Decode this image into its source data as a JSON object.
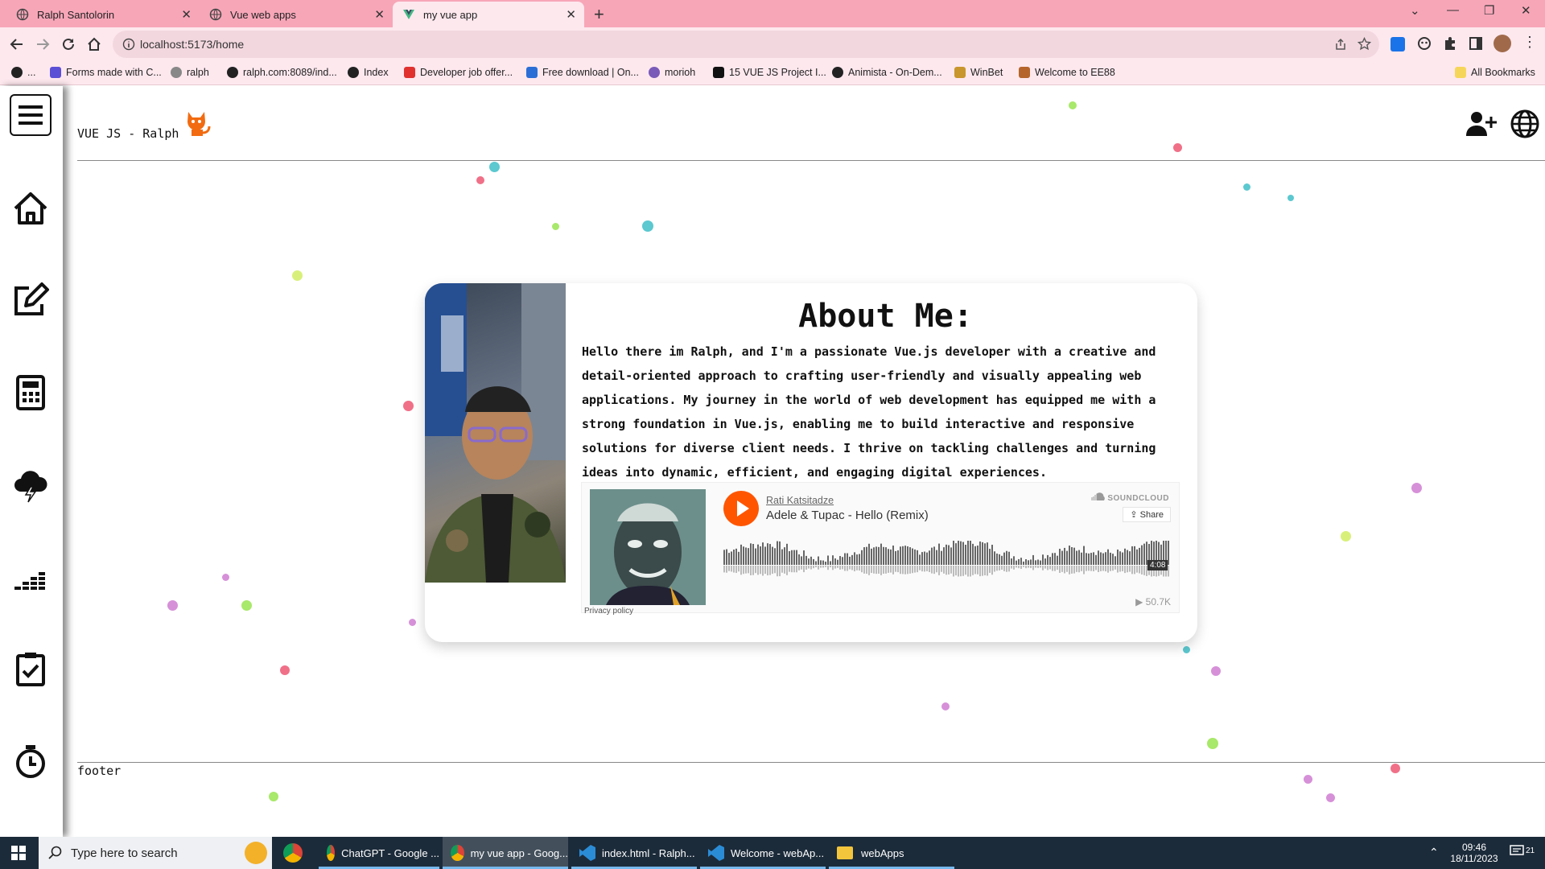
{
  "browser": {
    "tabs": [
      {
        "label": "Ralph Santolorin"
      },
      {
        "label": "Vue web apps"
      },
      {
        "label": "my vue app"
      }
    ],
    "url": "localhost:5173/home",
    "bookmarks": [
      {
        "label": "..."
      },
      {
        "label": "Forms made with C..."
      },
      {
        "label": "ralph"
      },
      {
        "label": "ralph.com:8089/ind..."
      },
      {
        "label": "Index"
      },
      {
        "label": "Developer job offer..."
      },
      {
        "label": "Free download | On..."
      },
      {
        "label": "morioh"
      },
      {
        "label": "15 VUE JS Project I..."
      },
      {
        "label": "Animista - On-Dem..."
      },
      {
        "label": "WinBet"
      },
      {
        "label": "Welcome to EE88"
      }
    ],
    "all_bookmarks": "All Bookmarks"
  },
  "app": {
    "title": "VUE JS - Ralph",
    "footer": "footer",
    "card": {
      "heading": "About Me:",
      "bio": "Hello there im Ralph, and I'm a passionate Vue.js developer with a creative and detail-oriented approach to crafting user-friendly and visually appealing web applications. My journey in the world of web development has equipped me with a strong foundation in Vue.js, enabling me to build interactive and responsive solutions for diverse client needs. I thrive on tackling challenges and turning ideas into dynamic, efficient, and engaging digital experiences."
    },
    "soundcloud": {
      "artist": "Rati Katsitadze",
      "track": "Adele & Tupac - Hello (Remix)",
      "brand": "SOUNDCLOUD",
      "share": "Share",
      "duration": "4:08",
      "plays": "50.7K",
      "privacy": "Privacy policy"
    }
  },
  "taskbar": {
    "search_placeholder": "Type here to search",
    "tasks": [
      {
        "label": "ChatGPT - Google ..."
      },
      {
        "label": "my vue app - Goog..."
      },
      {
        "label": "index.html - Ralph..."
      },
      {
        "label": "Welcome - webAp..."
      },
      {
        "label": "webApps"
      }
    ],
    "time": "09:46",
    "date": "18/11/2023",
    "notifications": "21"
  },
  "colors": {
    "tab_bar": "#f7a6b8",
    "toolbar": "#fde8ee",
    "soundcloud_orange": "#ff5500",
    "cat_icon": "#f26b10"
  }
}
